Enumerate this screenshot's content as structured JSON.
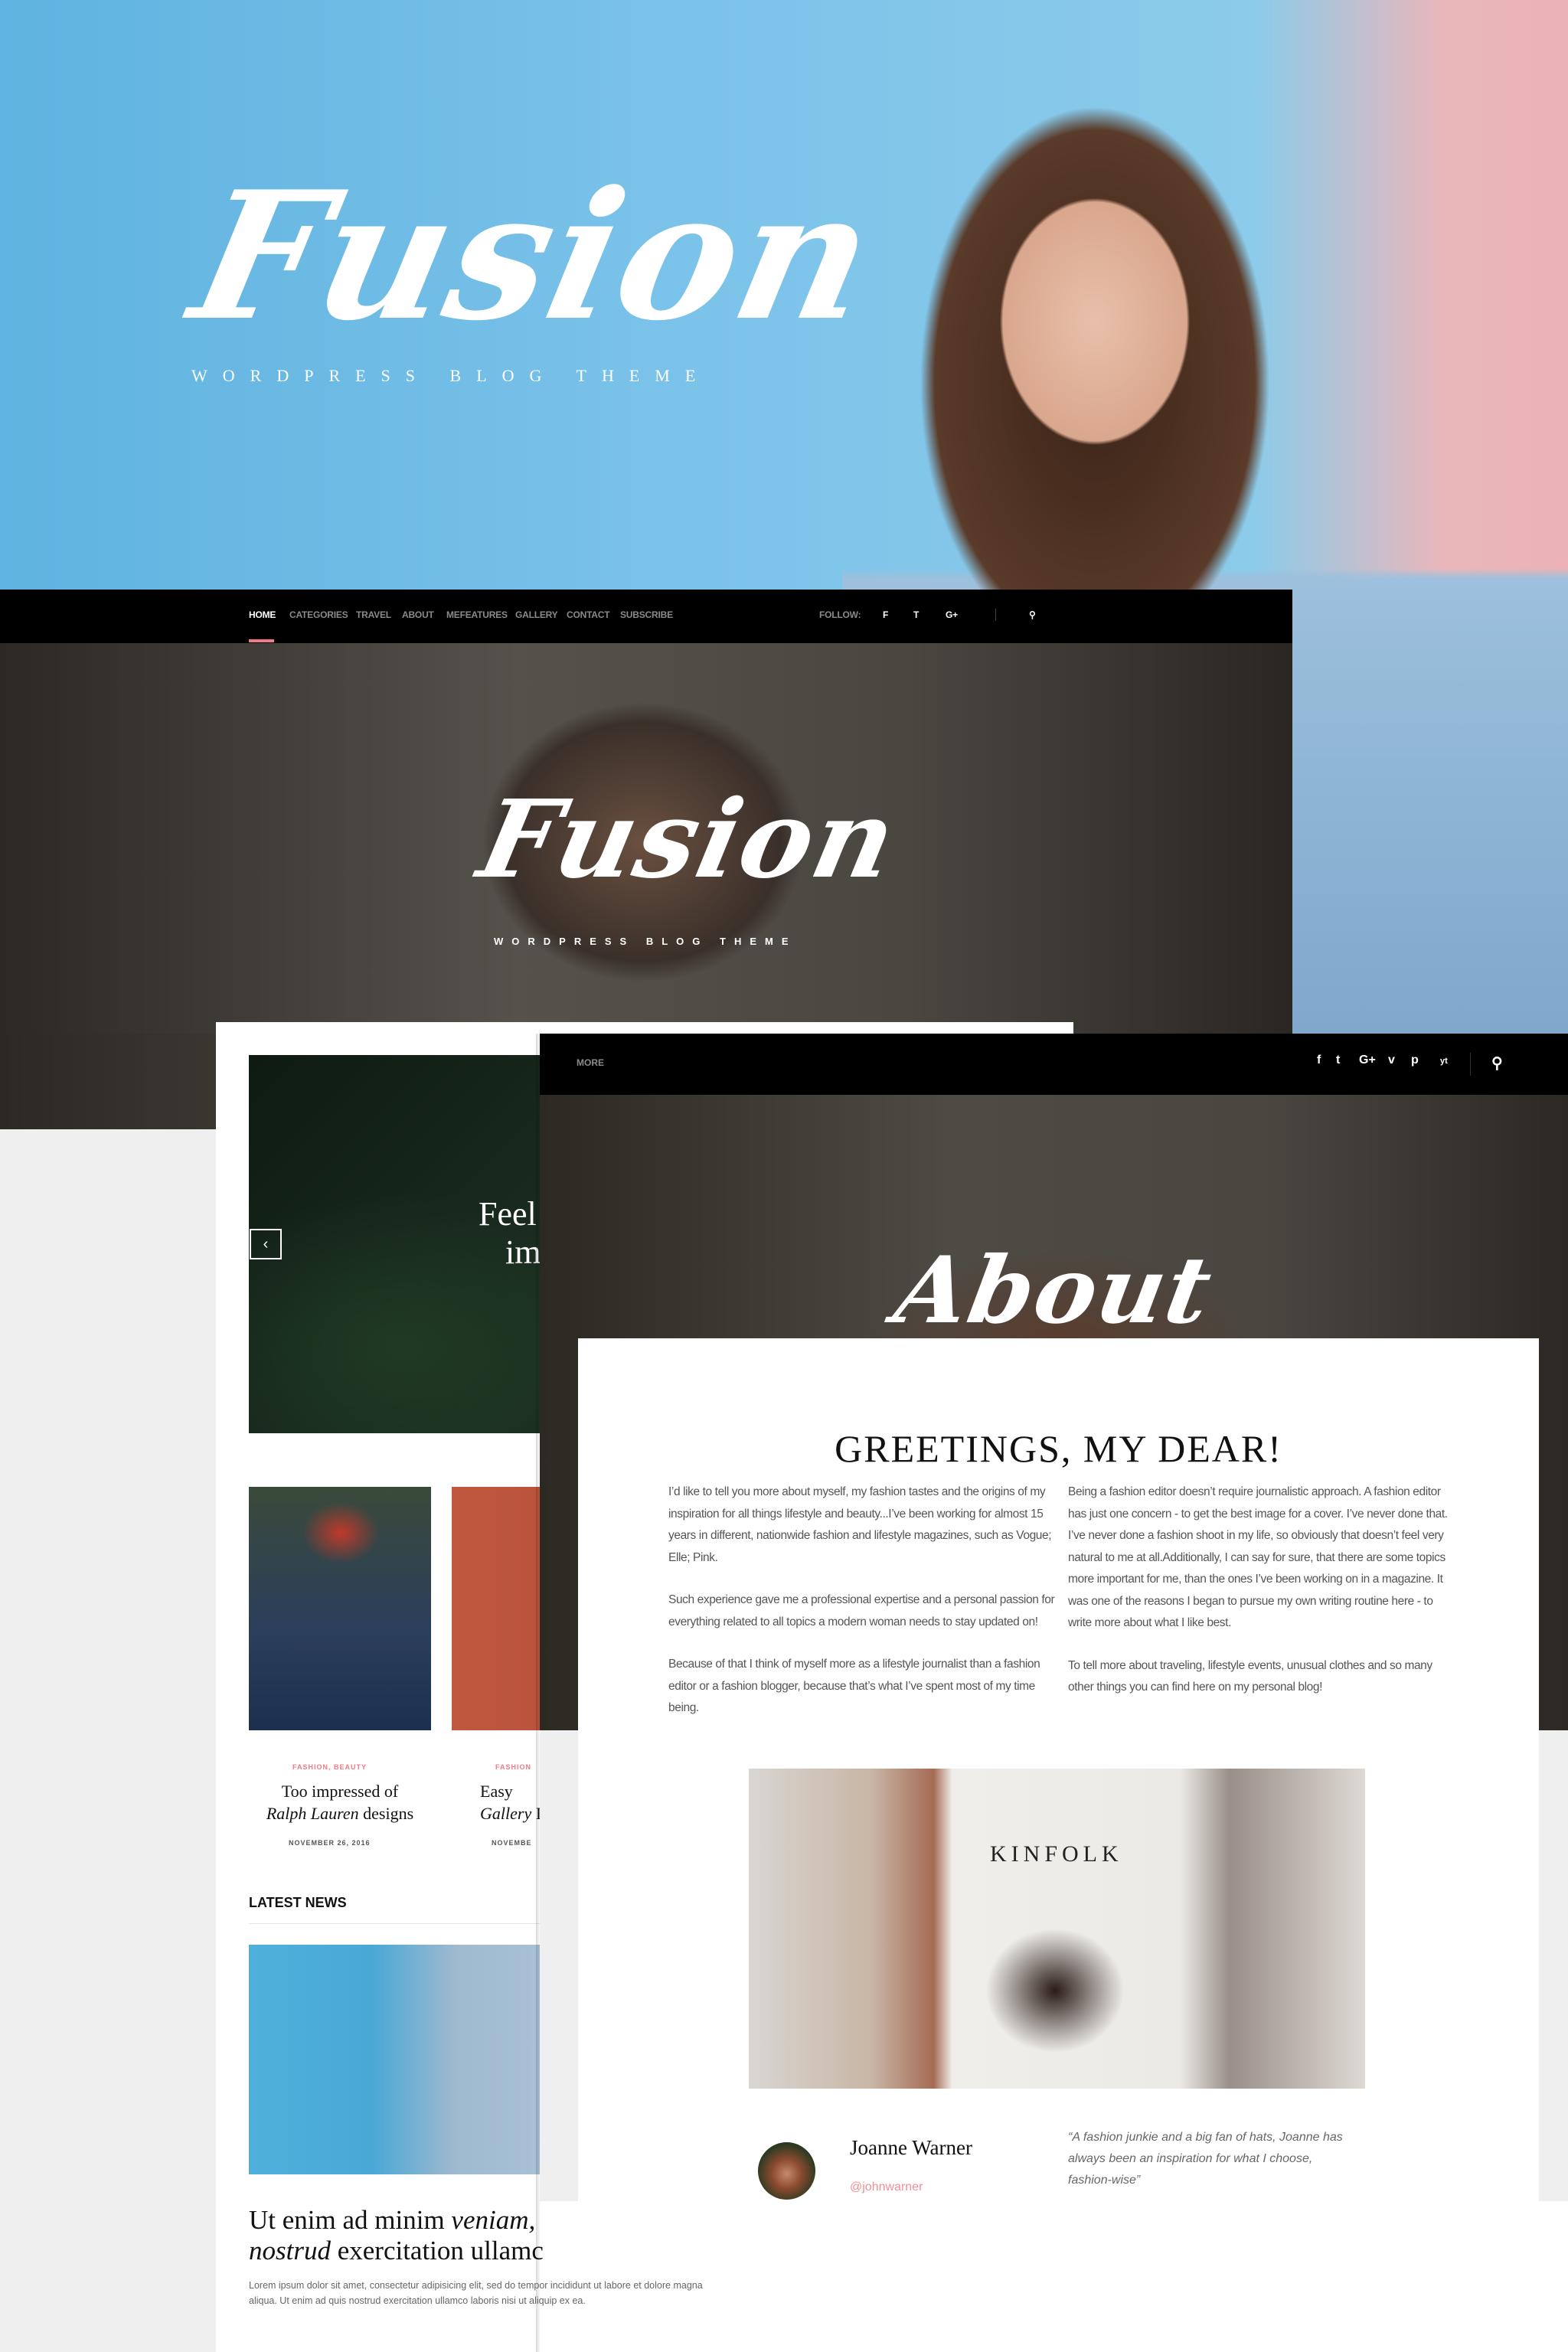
{
  "hero": {
    "logo": "Fusion",
    "subtitle": "WORDPRESS BLOG THEME"
  },
  "screen1": {
    "nav": [
      {
        "label": "HOME",
        "active": true
      },
      {
        "label": "CATEGORIES"
      },
      {
        "label": "TRAVEL"
      },
      {
        "label": "ABOUT"
      },
      {
        "label": "MEFEATURES"
      },
      {
        "label": "GALLERY"
      },
      {
        "label": "CONTACT"
      },
      {
        "label": "SUBSCRIBE"
      }
    ],
    "follow_label": "FOLLOW:",
    "social": [
      "f",
      "t",
      "G+"
    ],
    "search_icon": "search-icon",
    "active_color": "#f07a85",
    "logo": "Fusion",
    "subtitle": "WORDPRESS BLOG THEME"
  },
  "screen2": {
    "slider": {
      "prev": "‹",
      "text_line1": "Feel",
      "text_line2": "im"
    },
    "cards": [
      {
        "category": "FASHION, BEAUTY",
        "title_a": "Too impressed of",
        "title_b": "Ralph Lauren",
        "title_c": " designs",
        "date": "NOVEMBER 26, 2016"
      },
      {
        "category": "FASHION",
        "title_a": "Easy",
        "title_b": "Gallery",
        "title_c": " I",
        "date": "NOVEMBE"
      }
    ],
    "latest_title": "LATEST NEWS",
    "headline_a": "Ut enim ad minim ",
    "headline_b": "veniam,",
    "headline_c": "nostrud",
    "headline_d": " exercitation ullamc",
    "lorem": "Lorem ipsum dolor sit amet, consectetur adipisicing elit, sed do tempor incididunt ut labore et dolore magna aliqua. Ut enim ad quis nostrud exercitation ullamco laboris nisi ut aliquip ex ea."
  },
  "screen3": {
    "nav_more": "MORE",
    "social": [
      "f",
      "t",
      "G+",
      "v",
      "p",
      "yt"
    ],
    "page_title": "About",
    "heading": "GREETINGS, MY DEAR!",
    "col1": [
      "I’d like to tell you more about myself, my fashion tastes and the origins of my inspiration for all things lifestyle and beauty...I’ve been working for almost 15 years in different, nationwide fashion and lifestyle magazines, such as Vogue; Elle; Pink.",
      "Such experience gave me a professional expertise and a personal passion for everything related to all topics a modern woman needs to stay updated on!",
      "Because of that I think of myself more as a lifestyle journalist than a fashion editor or a fashion blogger, because that’s what I’ve spent most of my time being."
    ],
    "col2": [
      "Being a fashion editor doesn’t require journalistic approach. A fashion editor has just one concern - to get the best image for a cover. I’ve never done that. I’ve never done a fashion shoot in my life, so obviously that doesn’t feel very natural to me at all.Additionally, I can say for sure, that there are some topics more important for me, than the ones I’ve been working on in a magazine. It was one of the reasons I began to pursue my own writing routine here - to write more about what I like best.",
      "To tell more about traveling, lifestyle events, unusual clothes and so many other things you can find here on my personal blog!"
    ],
    "image_text": "KINFOLK",
    "author": {
      "name": "Joanne Warner",
      "handle": "@johnwarner",
      "quote": "“A fashion junkie and a big fan of hats, Joanne has always been an inspiration for what I choose, fashion-wise”"
    }
  }
}
